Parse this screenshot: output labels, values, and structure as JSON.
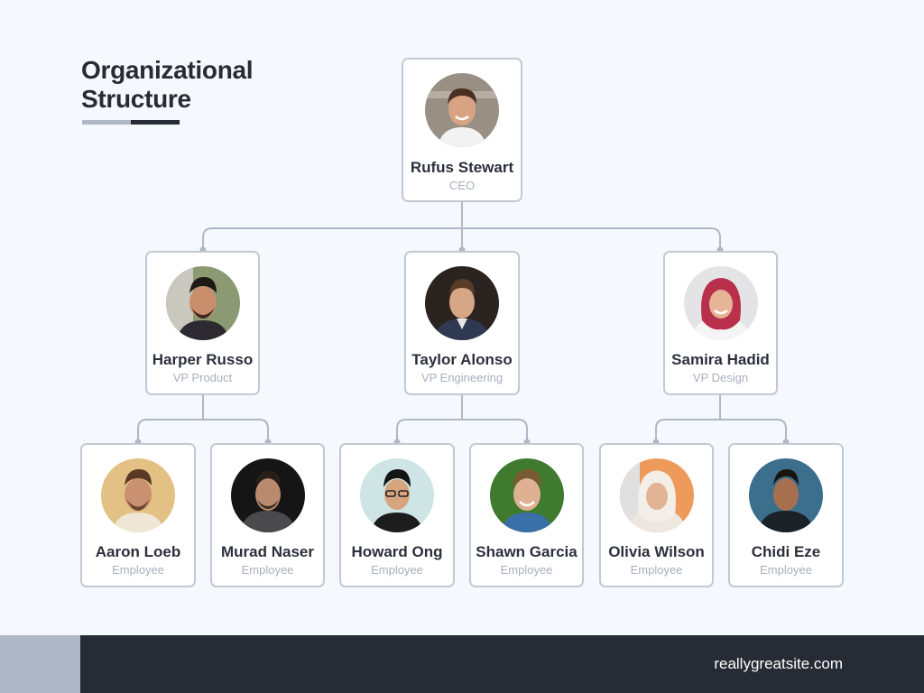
{
  "title": {
    "line1": "Organizational",
    "line2": "Structure"
  },
  "colors": {
    "background": "#f5f8fc",
    "dark": "#262b35",
    "accent": "#b0b8c8",
    "card_border": "#c3c9d4",
    "role_text": "#a8afbc"
  },
  "ceo": {
    "name": "Rufus Stewart",
    "role": "CEO",
    "icon": "avatar-photo"
  },
  "vps": [
    {
      "name": "Harper Russo",
      "role": "VP Product",
      "icon": "avatar-photo"
    },
    {
      "name": "Taylor Alonso",
      "role": "VP Engineering",
      "icon": "avatar-photo"
    },
    {
      "name": "Samira Hadid",
      "role": "VP Design",
      "icon": "avatar-photo"
    }
  ],
  "employees": [
    {
      "name": "Aaron Loeb",
      "role": "Employee",
      "icon": "avatar-photo"
    },
    {
      "name": "Murad Naser",
      "role": "Employee",
      "icon": "avatar-photo"
    },
    {
      "name": "Howard Ong",
      "role": "Employee",
      "icon": "avatar-photo"
    },
    {
      "name": "Shawn Garcia",
      "role": "Employee",
      "icon": "avatar-photo"
    },
    {
      "name": "Olivia Wilson",
      "role": "Employee",
      "icon": "avatar-photo"
    },
    {
      "name": "Chidi Eze",
      "role": "Employee",
      "icon": "avatar-photo"
    }
  ],
  "footer": {
    "url": "reallygreatsite.com"
  }
}
